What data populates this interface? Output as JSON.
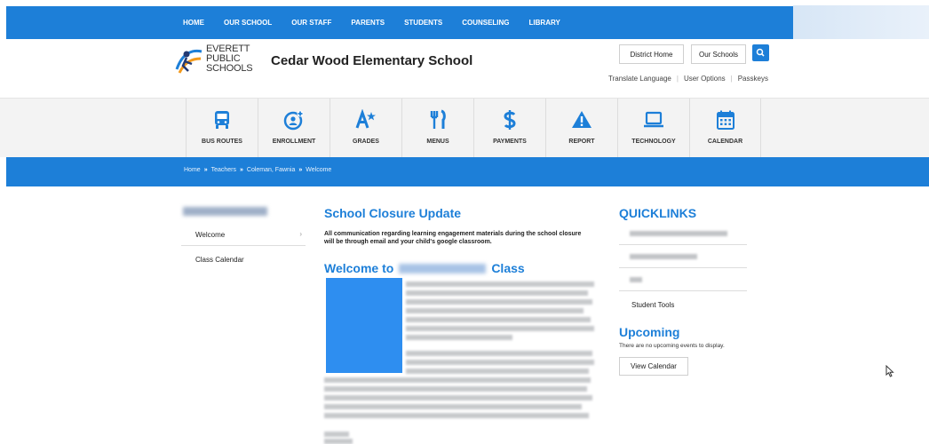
{
  "topnav": {
    "items": [
      "HOME",
      "OUR SCHOOL",
      "OUR STAFF",
      "PARENTS",
      "STUDENTS",
      "COUNSELING",
      "LIBRARY"
    ]
  },
  "header": {
    "logo_lines": [
      "EVERETT",
      "PUBLIC",
      "SCHOOLS"
    ],
    "school_name": "Cedar Wood Elementary School",
    "district_home": "District Home",
    "our_schools": "Our Schools",
    "utilities": [
      "Translate Language",
      "User Options",
      "Passkeys"
    ]
  },
  "quickbar": {
    "items": [
      {
        "label": "BUS ROUTES",
        "icon": "bus-icon"
      },
      {
        "label": "ENROLLMENT",
        "icon": "enrollment-icon"
      },
      {
        "label": "GRADES",
        "icon": "grades-icon"
      },
      {
        "label": "MENUS",
        "icon": "menus-icon"
      },
      {
        "label": "PAYMENTS",
        "icon": "payments-icon"
      },
      {
        "label": "REPORT",
        "icon": "report-icon"
      },
      {
        "label": "TECHNOLOGY",
        "icon": "technology-icon"
      },
      {
        "label": "CALENDAR",
        "icon": "calendar-icon"
      }
    ]
  },
  "breadcrumb": [
    "Home",
    "Teachers",
    "Coleman, Fawnia",
    "Welcome"
  ],
  "breadcrumb_sep": "»",
  "sidebar": {
    "items": [
      "Welcome",
      "Class Calendar"
    ],
    "chevron": "›"
  },
  "main": {
    "closure_title": "School Closure Update",
    "closure_body": "All communication regarding learning engagement materials during the school closure will be through email and your child's google classroom.",
    "welcome_prefix": "Welcome to",
    "welcome_suffix": "Class"
  },
  "right": {
    "quicklinks_title": "QUICKLINKS",
    "student_tools": "Student Tools",
    "upcoming_title": "Upcoming",
    "upcoming_note": "There are no upcoming events to display.",
    "view_calendar": "View Calendar"
  },
  "colors": {
    "brand_blue": "#1d7fd8",
    "photo_blue": "#2e8ef0"
  }
}
